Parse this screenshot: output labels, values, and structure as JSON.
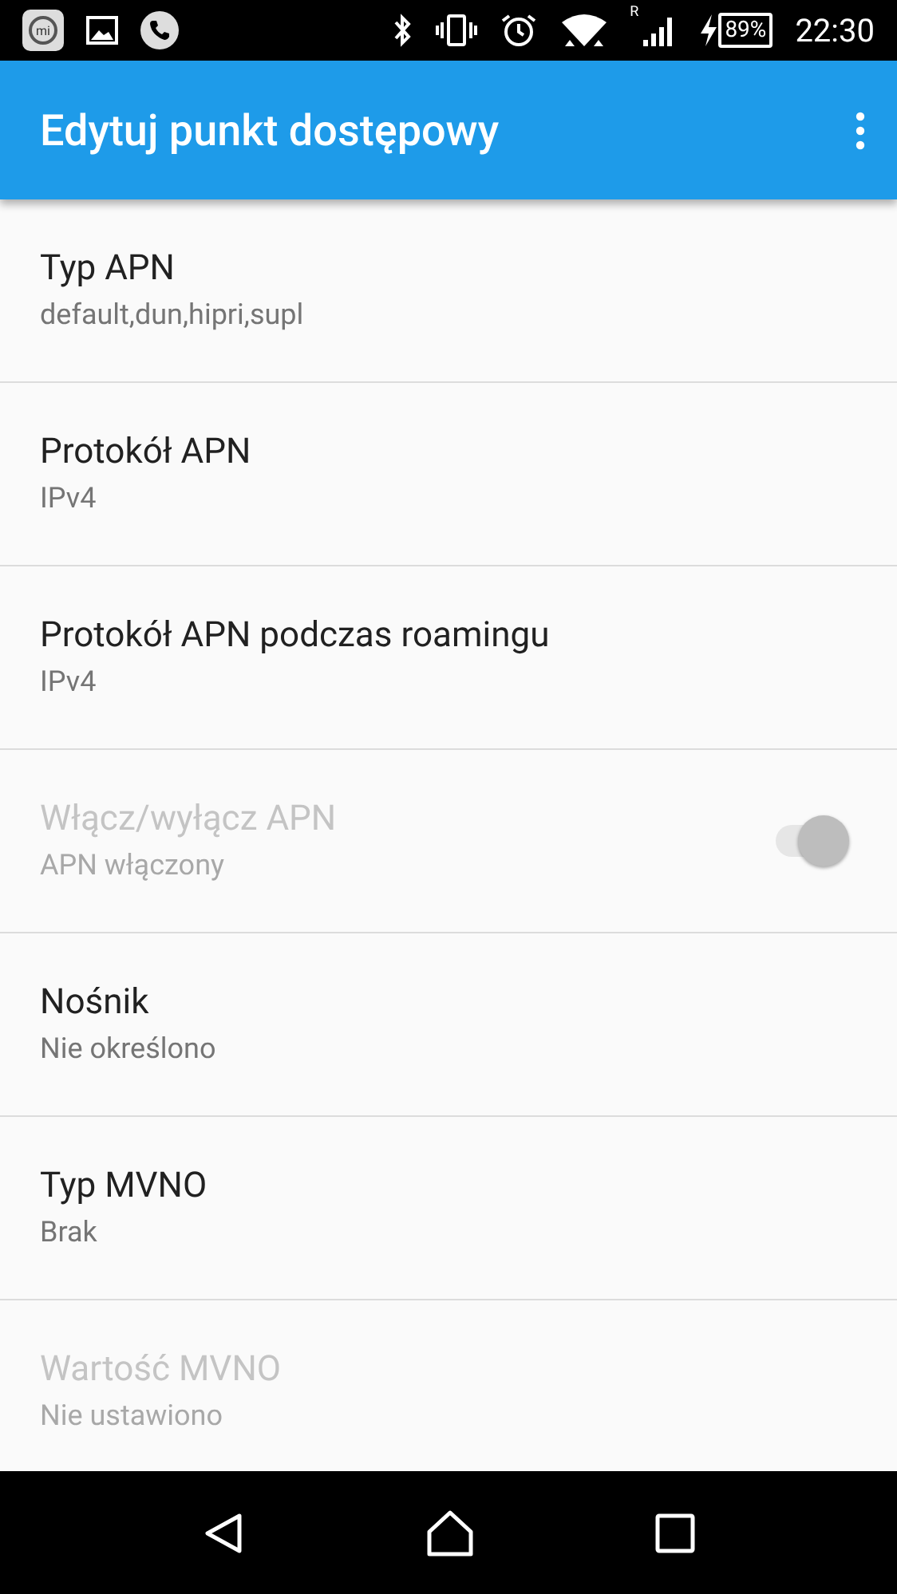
{
  "status_bar": {
    "app_icon_label": "mi",
    "roaming": "R",
    "battery": "89%",
    "time": "22:30"
  },
  "app_bar": {
    "title": "Edytuj punkt dostępowy"
  },
  "settings": [
    {
      "kind": "text",
      "title": "Typ APN",
      "summary": "default,dun,hipri,supl",
      "disabled": false
    },
    {
      "kind": "text",
      "title": "Protokół APN",
      "summary": "IPv4",
      "disabled": false
    },
    {
      "kind": "text",
      "title": "Protokół APN podczas roamingu",
      "summary": "IPv4",
      "disabled": false
    },
    {
      "kind": "switch",
      "title": "Włącz/wyłącz APN",
      "summary": "APN włączony",
      "disabled": true,
      "on": true
    },
    {
      "kind": "text",
      "title": "Nośnik",
      "summary": "Nie określono",
      "disabled": false
    },
    {
      "kind": "text",
      "title": "Typ MVNO",
      "summary": "Brak",
      "disabled": false
    },
    {
      "kind": "text",
      "title": "Wartość MVNO",
      "summary": "Nie ustawiono",
      "disabled": true
    }
  ]
}
